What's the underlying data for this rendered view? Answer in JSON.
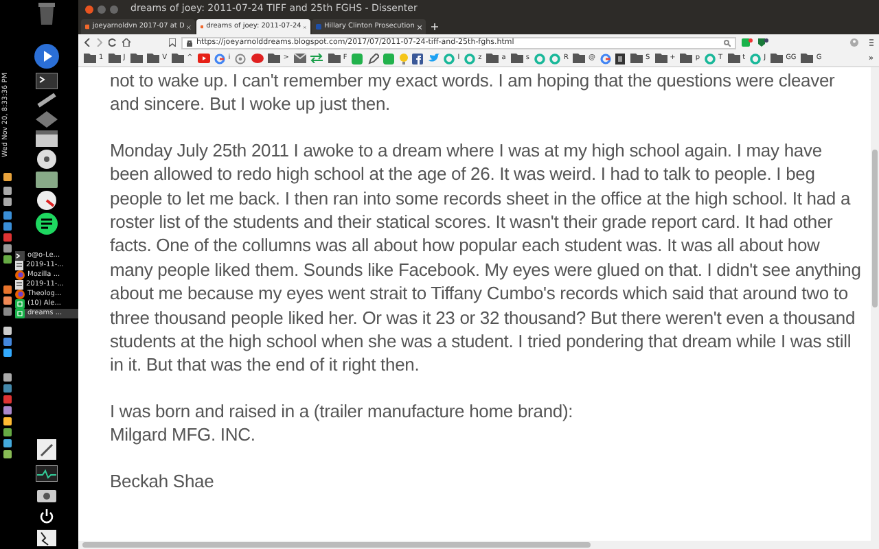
{
  "clock": "Wed Nov 20, 8:33:36 PM",
  "taskbar": [
    {
      "label": "o@o-Le...",
      "kind": "terminal",
      "selected": false
    },
    {
      "label": "2019-11-...",
      "kind": "doc",
      "selected": false
    },
    {
      "label": "Mozilla ...",
      "kind": "firefox",
      "selected": false
    },
    {
      "label": "2019-11-...",
      "kind": "doc",
      "selected": false
    },
    {
      "label": "Theolog...",
      "kind": "firefox",
      "selected": false
    },
    {
      "label": "(10) Ale...",
      "kind": "dissenter",
      "selected": false
    },
    {
      "label": "dreams ...",
      "kind": "dissenter",
      "selected": true
    }
  ],
  "window": {
    "title": "dreams of joey: 2011-07-24 TIFF and 25th FGHS - Dissenter"
  },
  "tabs": [
    {
      "label": "joeyarnoldvn 2017-07 at D",
      "selected": false
    },
    {
      "label": "dreams of joey: 2011-07-24",
      "selected": true
    },
    {
      "label": "Hillary Clinton Prosecution",
      "selected": false
    }
  ],
  "address": {
    "value": "https://joeyarnolddreams.blogspot.com/2017/07/2011-07-24-tiff-and-25th-fghs.html"
  },
  "bookmarks": [
    {
      "kind": "folder",
      "label": "1"
    },
    {
      "kind": "folder",
      "label": "J"
    },
    {
      "kind": "folder"
    },
    {
      "kind": "folder",
      "label": "V"
    },
    {
      "kind": "folder",
      "label": "^"
    },
    {
      "kind": "video"
    },
    {
      "kind": "google",
      "label": "i"
    },
    {
      "kind": "circle"
    },
    {
      "kind": "chat"
    },
    {
      "kind": "folder",
      "label": ">"
    },
    {
      "kind": "mail"
    },
    {
      "kind": "arrows"
    },
    {
      "kind": "folder",
      "label": "F"
    },
    {
      "kind": "green"
    },
    {
      "kind": "note"
    },
    {
      "kind": "green"
    },
    {
      "kind": "bulb"
    },
    {
      "kind": "facebook"
    },
    {
      "kind": "bird"
    },
    {
      "kind": "loop",
      "label": "l"
    },
    {
      "kind": "loop",
      "label": "z"
    },
    {
      "kind": "folder",
      "label": "a"
    },
    {
      "kind": "folder",
      "label": "s"
    },
    {
      "kind": "loop"
    },
    {
      "kind": "loop",
      "label": "R"
    },
    {
      "kind": "folder",
      "label": "@"
    },
    {
      "kind": "google"
    },
    {
      "kind": "dark"
    },
    {
      "kind": "folder",
      "label": "S"
    },
    {
      "kind": "folder",
      "label": "+"
    },
    {
      "kind": "folder",
      "label": "p"
    },
    {
      "kind": "loop",
      "label": "T"
    },
    {
      "kind": "folder",
      "label": "t"
    },
    {
      "kind": "loop",
      "label": "J"
    },
    {
      "kind": "folder",
      "label": "GG"
    },
    {
      "kind": "folder",
      "label": "G"
    }
  ],
  "bookmarks_more": "»",
  "paragraphs": [
    "not to wake up. I can't remember my exact words. I am hoping that the questions were cleaver and sincere. But I woke up just then.",
    "Monday July 25th 2011 I awoke to a dream where I was at my high school again. I may have been allowed to redo high school at the age of 26. It was weird. I had to talk to people. I beg people to let me back. I then ran into some records sheet in the office at the high school. It had a roster list of the students and their statical scores. It wasn't their grade report card. It had other facts. One of the collumns was all about how popular each student was. It was all about how many people liked them. Sounds like Facebook. My eyes were glued on that. I didn't see anything about me because my eyes went strait to Tiffany Cumbo's records which said that around two to three thousand people liked her. Or was it 23 or 32 thousand? But there weren't even a thousand students at the high school when she was a student. I tried pondering that dream while I was still in it. But that was the end of it right then.",
    "I was born and raised in a (trailer manufacture home brand):\nMilgard MFG. INC.",
    "Beckah Shae"
  ]
}
